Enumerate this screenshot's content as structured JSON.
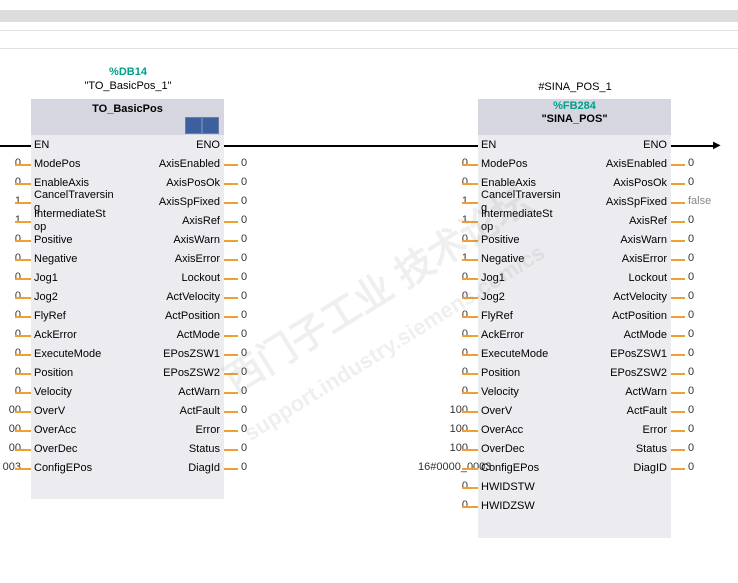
{
  "left": {
    "db": "%DB14",
    "instance": "\"TO_BasicPos_1\"",
    "name": "TO_BasicPos",
    "en": "EN",
    "eno": "ENO",
    "inputs": [
      {
        "pin": "ModePos",
        "value": "0"
      },
      {
        "pin": "EnableAxis",
        "value": "0"
      },
      {
        "pin": "CancelTraversin\ng",
        "value": "1"
      },
      {
        "pin": "IntermediateSt\nop",
        "value": "1"
      },
      {
        "pin": "Positive",
        "value": "0"
      },
      {
        "pin": "Negative",
        "value": "0"
      },
      {
        "pin": "Jog1",
        "value": "0"
      },
      {
        "pin": "Jog2",
        "value": "0"
      },
      {
        "pin": "FlyRef",
        "value": "0"
      },
      {
        "pin": "AckError",
        "value": "0"
      },
      {
        "pin": "ExecuteMode",
        "value": "0"
      },
      {
        "pin": "Position",
        "value": "0"
      },
      {
        "pin": "Velocity",
        "value": "0"
      },
      {
        "pin": "OverV",
        "value": "00"
      },
      {
        "pin": "OverAcc",
        "value": "00"
      },
      {
        "pin": "OverDec",
        "value": "00"
      },
      {
        "pin": "ConfigEPos",
        "value": "003"
      }
    ],
    "outputs": [
      {
        "pin": "AxisEnabled",
        "value": "0"
      },
      {
        "pin": "AxisPosOk",
        "value": "0"
      },
      {
        "pin": "AxisSpFixed",
        "value": "0"
      },
      {
        "pin": "AxisRef",
        "value": "0"
      },
      {
        "pin": "AxisWarn",
        "value": "0"
      },
      {
        "pin": "AxisError",
        "value": "0"
      },
      {
        "pin": "Lockout",
        "value": "0"
      },
      {
        "pin": "ActVelocity",
        "value": "0"
      },
      {
        "pin": "ActPosition",
        "value": "0"
      },
      {
        "pin": "ActMode",
        "value": "0"
      },
      {
        "pin": "EPosZSW1",
        "value": "0"
      },
      {
        "pin": "EPosZSW2",
        "value": "0"
      },
      {
        "pin": "ActWarn",
        "value": "0"
      },
      {
        "pin": "ActFault",
        "value": "0"
      },
      {
        "pin": "Error",
        "value": "0"
      },
      {
        "pin": "Status",
        "value": "0"
      },
      {
        "pin": "DiagId",
        "value": "0"
      }
    ]
  },
  "right": {
    "instance": "#SINA_POS_1",
    "fb": "%FB284",
    "name": "\"SINA_POS\"",
    "en": "EN",
    "eno": "ENO",
    "inputs": [
      {
        "pin": "ModePos",
        "value": "0"
      },
      {
        "pin": "EnableAxis",
        "value": "0"
      },
      {
        "pin": "CancelTraversin\ng",
        "value": "1"
      },
      {
        "pin": "IntermediateSt\nop",
        "value": "1"
      },
      {
        "pin": "Positive",
        "value": "0"
      },
      {
        "pin": "Negative",
        "value": "1"
      },
      {
        "pin": "Jog1",
        "value": "0"
      },
      {
        "pin": "Jog2",
        "value": "0"
      },
      {
        "pin": "FlyRef",
        "value": "0"
      },
      {
        "pin": "AckError",
        "value": "0"
      },
      {
        "pin": "ExecuteMode",
        "value": "0"
      },
      {
        "pin": "Position",
        "value": "0"
      },
      {
        "pin": "Velocity",
        "value": "0"
      },
      {
        "pin": "OverV",
        "value": "100"
      },
      {
        "pin": "OverAcc",
        "value": "100"
      },
      {
        "pin": "OverDec",
        "value": "100"
      },
      {
        "pin": "ConfigEPos",
        "value": "16#0000_0003"
      },
      {
        "pin": "HWIDSTW",
        "value": "0"
      },
      {
        "pin": "HWIDZSW",
        "value": "0"
      }
    ],
    "outputs": [
      {
        "pin": "AxisEnabled",
        "value": "0"
      },
      {
        "pin": "AxisPosOk",
        "value": "0"
      },
      {
        "pin": "AxisSpFixed",
        "value": "false"
      },
      {
        "pin": "AxisRef",
        "value": "0"
      },
      {
        "pin": "AxisWarn",
        "value": "0"
      },
      {
        "pin": "AxisError",
        "value": "0"
      },
      {
        "pin": "Lockout",
        "value": "0"
      },
      {
        "pin": "ActVelocity",
        "value": "0"
      },
      {
        "pin": "ActPosition",
        "value": "0"
      },
      {
        "pin": "ActMode",
        "value": "0"
      },
      {
        "pin": "EPosZSW1",
        "value": "0"
      },
      {
        "pin": "EPosZSW2",
        "value": "0"
      },
      {
        "pin": "ActWarn",
        "value": "0"
      },
      {
        "pin": "ActFault",
        "value": "0"
      },
      {
        "pin": "Error",
        "value": "0"
      },
      {
        "pin": "Status",
        "value": "0"
      },
      {
        "pin": "DiagID",
        "value": "0"
      }
    ]
  },
  "watermark": {
    "line1": "西门子工业 技术论坛",
    "line2": "support.industry.siemens.com/cs"
  },
  "colors": {
    "wire": "#f0a030",
    "block": "#ececf0",
    "title": "#d6d6e0",
    "accent": "#00a08a"
  }
}
